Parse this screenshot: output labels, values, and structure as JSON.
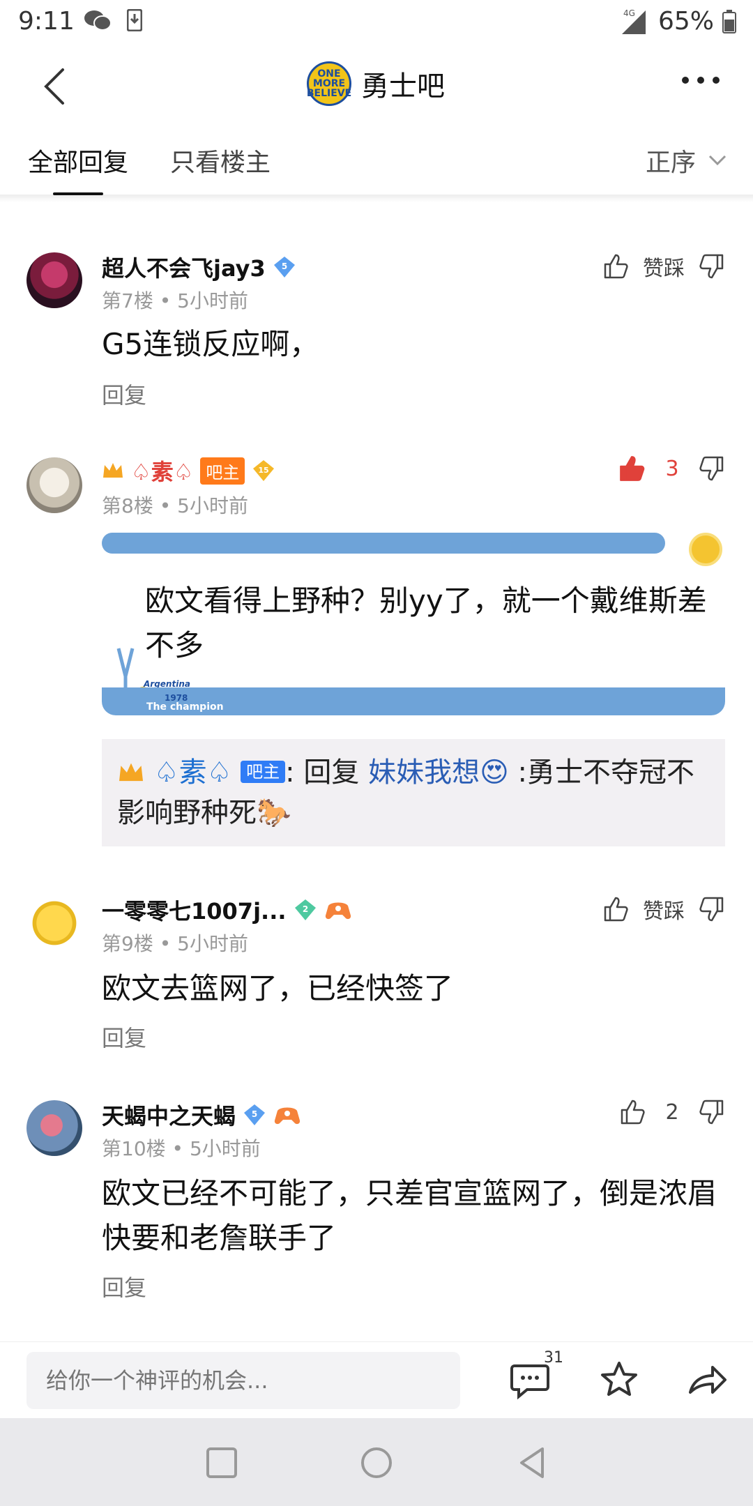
{
  "status_bar": {
    "time": "9:11",
    "network": "4G",
    "battery": "65%"
  },
  "header": {
    "forum_logo_text": "ONE MORE BELIEVE",
    "forum_name": "勇士吧"
  },
  "tabs": {
    "all": "全部回复",
    "op_only": "只看楼主",
    "order": "正序"
  },
  "cutoff_reply": "回复",
  "posts": [
    {
      "username": "超人不会飞jay3",
      "level": "5",
      "floor": "第7楼",
      "time": "5小时前",
      "content": "G5连锁反应啊，",
      "vote_label": "赞踩",
      "reply": "回复"
    },
    {
      "username": "♤素♤",
      "role": "吧主",
      "level": "15",
      "floor": "第8楼",
      "time": "5小时前",
      "content": "欧文看得上野种？别yy了，就一个戴维斯差不多",
      "likes": "3",
      "theme": {
        "argentina": "Argentina",
        "year": "1978",
        "champion": "The champion"
      },
      "quote": {
        "name": "♤素♤",
        "role": "吧主",
        "reply_prefix": "回复",
        "target": "妹妹我想😍",
        "text": ":勇士不夺冠不影响野种死🐎"
      }
    },
    {
      "username": "一零零七1007j...",
      "level": "2",
      "floor": "第9楼",
      "time": "5小时前",
      "content": "欧文去篮网了，已经快签了",
      "vote_label": "赞踩",
      "reply": "回复"
    },
    {
      "username": "天蝎中之天蝎",
      "level": "5",
      "floor": "第10楼",
      "time": "5小时前",
      "content": "欧文已经不可能了，只差官宣篮网了，倒是浓眉快要和老詹联手了",
      "likes": "2",
      "reply": "回复"
    }
  ],
  "bottom_bar": {
    "input_placeholder": "给你一个神评的机会...",
    "comment_count": "31"
  },
  "colors": {
    "accent_red": "#e0413a",
    "badge_orange": "#ff7a1a",
    "badge_blue": "#2f7cf6",
    "theme_blue": "#6ea3d8"
  },
  "icons": [
    "back-arrow-icon",
    "more-icon",
    "chevron-down-icon",
    "thumb-up-icon",
    "thumb-down-icon",
    "comment-icon",
    "star-icon",
    "share-icon",
    "wechat-icon",
    "download-icon",
    "signal-icon",
    "battery-icon",
    "crown-icon",
    "level-diamond-icon",
    "game-badge-icon"
  ]
}
